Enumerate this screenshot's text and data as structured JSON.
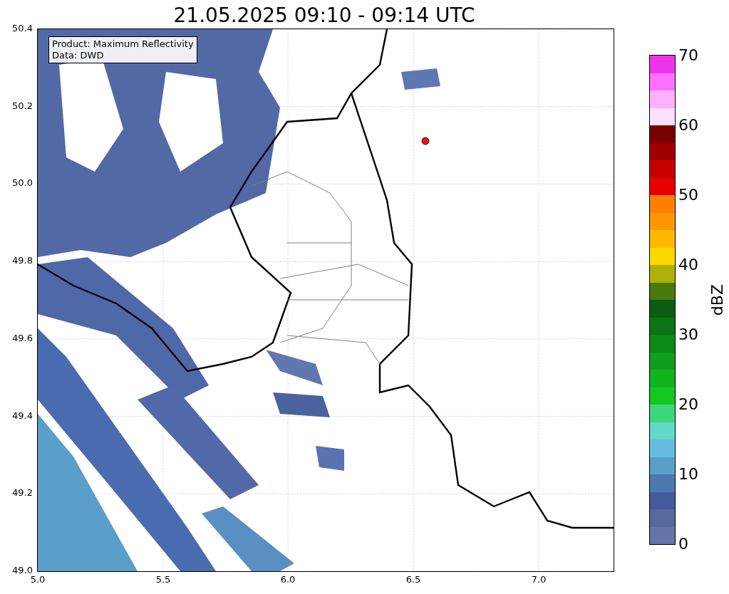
{
  "title": "21.05.2025 09:10 - 09:14 UTC",
  "map": {
    "legend": [
      "Product: Maximum Reflectivity",
      "Data: DWD"
    ],
    "xticks": [
      "5.0",
      "5.5",
      "6.0",
      "6.5",
      "7.0"
    ],
    "yticks": [
      "50.4",
      "50.2",
      "50.0",
      "49.8",
      "49.6",
      "49.4",
      "49.2",
      "49.0"
    ]
  },
  "colorbar": {
    "label": "dBZ",
    "ticks": [
      "70",
      "60",
      "50",
      "40",
      "30",
      "20",
      "10",
      "0"
    ],
    "bands": [
      {
        "color": "#6474a7"
      },
      {
        "color": "#566a9e"
      },
      {
        "color": "#445c9e"
      },
      {
        "color": "#4a7ab0"
      },
      {
        "color": "#5a9fc9"
      },
      {
        "color": "#64bde0"
      },
      {
        "color": "#62d8c9"
      },
      {
        "color": "#3dd67a"
      },
      {
        "color": "#12c823"
      },
      {
        "color": "#10b41e"
      },
      {
        "color": "#0f9f1b"
      },
      {
        "color": "#0d8a17"
      },
      {
        "color": "#0b7414"
      },
      {
        "color": "#0a5e11"
      },
      {
        "color": "#4a7a0c"
      },
      {
        "color": "#b0b00a"
      },
      {
        "color": "#ffd700"
      },
      {
        "color": "#ffb700"
      },
      {
        "color": "#ff9800"
      },
      {
        "color": "#ff7f00"
      },
      {
        "color": "#e80000"
      },
      {
        "color": "#c60000"
      },
      {
        "color": "#a00000"
      },
      {
        "color": "#7a0000"
      },
      {
        "color": "#ffe0ff"
      },
      {
        "color": "#ffb0ff"
      },
      {
        "color": "#ff70ff"
      },
      {
        "color": "#ee33ee"
      }
    ]
  }
}
